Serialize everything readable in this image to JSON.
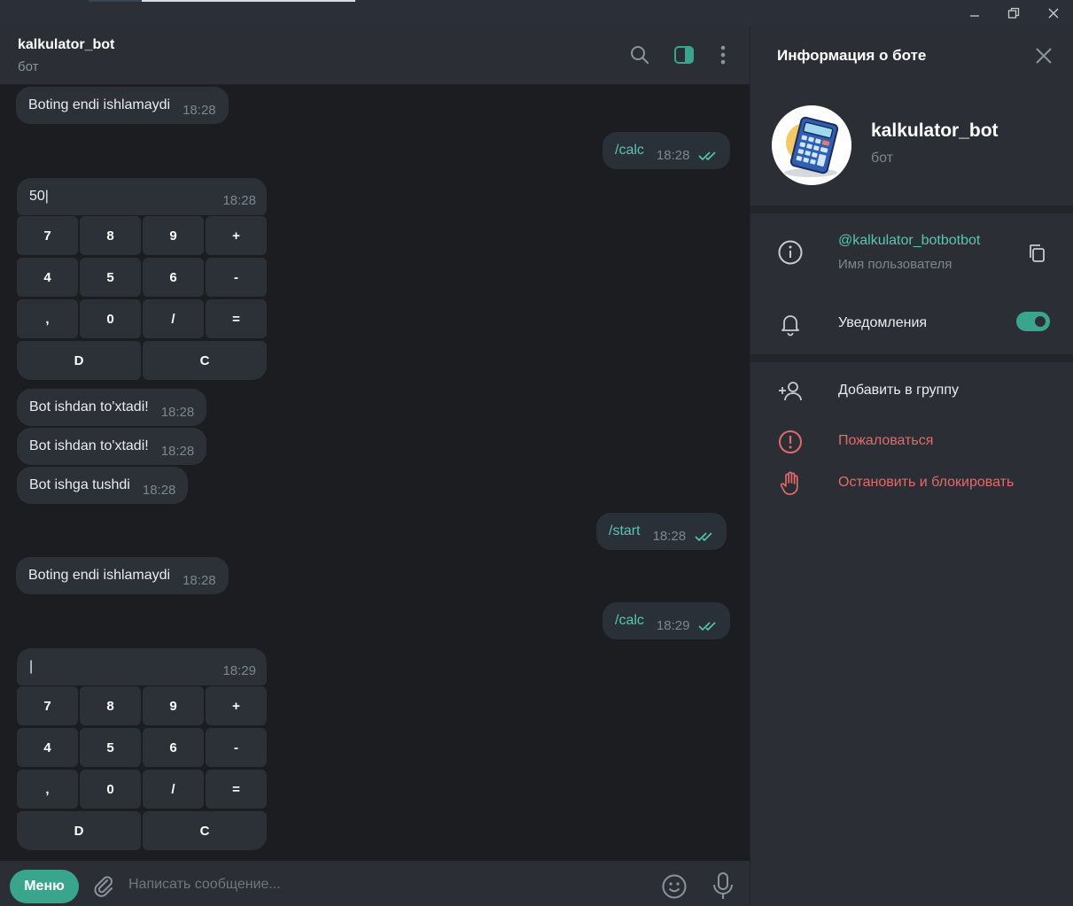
{
  "window": {
    "minimize": "minimize",
    "restore": "restore",
    "close": "close"
  },
  "header": {
    "title": "kalkulator_bot",
    "subtitle": "бот"
  },
  "messages": [
    {
      "text": "Boting endi ishlamaydi",
      "time": "18:28",
      "dir": "in"
    },
    {
      "text": "/calc",
      "time": "18:28",
      "dir": "out"
    },
    {
      "text": "Bot ishdan to'xtadi!",
      "time": "18:28",
      "dir": "in"
    },
    {
      "text": "Bot ishdan to'xtadi!",
      "time": "18:28",
      "dir": "in"
    },
    {
      "text": "Bot ishga tushdi",
      "time": "18:28",
      "dir": "in"
    },
    {
      "text": "/start",
      "time": "18:28",
      "dir": "out"
    },
    {
      "text": "Boting endi ishlamaydi",
      "time": "18:28",
      "dir": "in"
    },
    {
      "text": "/calc",
      "time": "18:29",
      "dir": "out"
    }
  ],
  "calculators": [
    {
      "display": "50|",
      "time": "18:28"
    },
    {
      "display": "|",
      "time": "18:29"
    }
  ],
  "keypad": [
    [
      "7",
      "8",
      "9",
      "+"
    ],
    [
      "4",
      "5",
      "6",
      "-"
    ],
    [
      ",",
      "0",
      "/",
      "="
    ],
    [
      "D",
      "C"
    ]
  ],
  "input": {
    "menu_label": "Меню",
    "placeholder": "Написать сообщение..."
  },
  "panel": {
    "title": "Информация о боте",
    "bot_name": "kalkulator_bot",
    "bot_sub": "бот",
    "username": "@kalkulator_botbotbot",
    "username_label": "Имя пользователя",
    "notifications_label": "Уведомления",
    "notifications_on": true,
    "add_group": "Добавить в группу",
    "report": "Пожаловаться",
    "block": "Остановить и блокировать"
  },
  "colors": {
    "accent": "#3aa58d",
    "link": "#55c7b3",
    "danger": "#e26a6a"
  }
}
